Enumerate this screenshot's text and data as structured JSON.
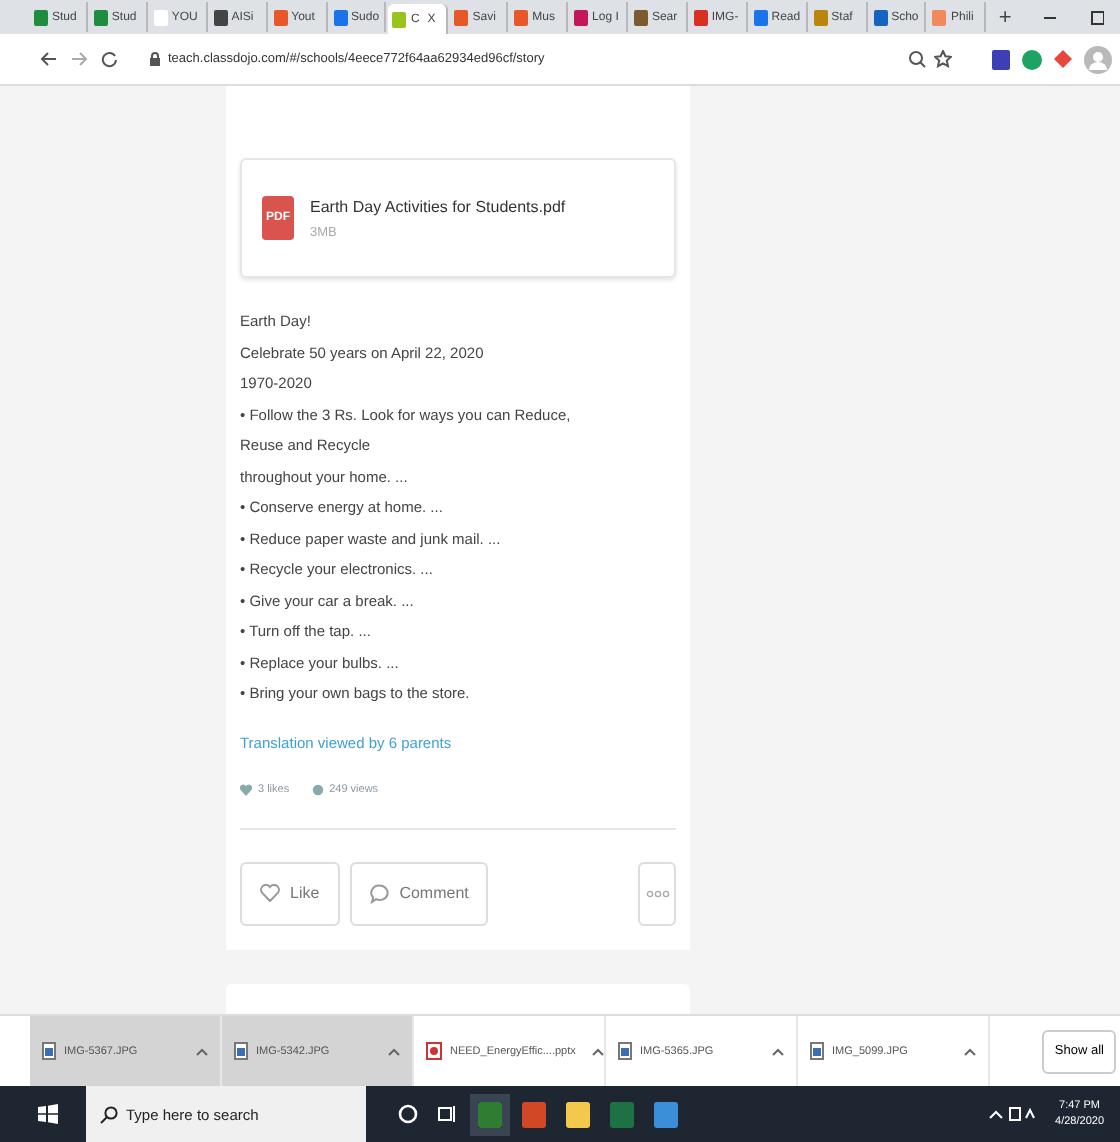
{
  "browser": {
    "tabs": [
      {
        "label": "Stud",
        "color": "#1e8e3e",
        "selected": false
      },
      {
        "label": "Stud",
        "color": "#1e8e3e",
        "selected": false
      },
      {
        "label": "YOU",
        "color": "#ffffff",
        "selected": false
      },
      {
        "label": "AISi",
        "color": "#444444",
        "selected": false
      },
      {
        "label": "Yout",
        "color": "#e8572a",
        "selected": false
      },
      {
        "label": "Sudo",
        "color": "#1a73e8",
        "selected": false
      },
      {
        "label": "C",
        "color": "#9ac31c",
        "selected": true
      },
      {
        "label": "Savi",
        "color": "#e8572a",
        "selected": false
      },
      {
        "label": "Mus",
        "color": "#e8572a",
        "selected": false
      },
      {
        "label": "Log I",
        "color": "#c2185b",
        "selected": false
      },
      {
        "label": "Sear",
        "color": "#7a5c2e",
        "selected": false
      },
      {
        "label": "IMG-",
        "color": "#d93025",
        "selected": false
      },
      {
        "label": "Read",
        "color": "#1a73e8",
        "selected": false
      },
      {
        "label": "Staf",
        "color": "#b8860b",
        "selected": false
      },
      {
        "label": "Scho",
        "color": "#1565c0",
        "selected": false
      },
      {
        "label": "Phili",
        "color": "#f08a5d",
        "selected": false
      }
    ],
    "close_tab": "X",
    "new_tab": "+",
    "url": "teach.classdojo.com/#/schools/4eece772f64aa62934ed96cf/story"
  },
  "post": {
    "attachment": {
      "name": "Earth Day Activities for Students.pdf",
      "size": "3MB",
      "badge": "PDF"
    },
    "lines": [
      "Earth Day!",
      "Celebrate 50 years on April 22, 2020",
      "1970-2020",
      "• Follow the 3 Rs. Look for ways you can Reduce,",
      "Reuse and Recycle",
      "throughout your home. ...",
      "• Conserve energy at home. ...",
      "• Reduce paper waste and junk mail. ...",
      "• Recycle your electronics. ...",
      "• Give your car a break. ...",
      "• Turn off the tap. ...",
      "• Replace your bulbs. ...",
      "• Bring your own bags to the store."
    ],
    "translation": "Translation viewed by 6 parents",
    "likes": "3 likes",
    "views": "249 views",
    "buttons": [
      {
        "label": "Like",
        "kind": "like"
      },
      {
        "label": "Comment",
        "kind": "comment"
      }
    ]
  },
  "downloads": {
    "items": [
      {
        "name": "IMG-5367.JPG",
        "kind": "image",
        "selected": true
      },
      {
        "name": "IMG-5342.JPG",
        "kind": "image",
        "selected": true
      },
      {
        "name": "NEED_EnergyEffic....pptx",
        "kind": "slides",
        "selected": false
      },
      {
        "name": "IMG-5365.JPG",
        "kind": "image",
        "selected": false
      },
      {
        "name": "IMG_5099.JPG",
        "kind": "image",
        "selected": false
      }
    ],
    "show_all": "Show all"
  },
  "taskbar": {
    "search_placeholder": "Type here to search",
    "apps": [
      {
        "kind": "cortana"
      },
      {
        "kind": "taskview"
      },
      {
        "kind": "chrome"
      },
      {
        "kind": "powerpoint"
      },
      {
        "kind": "files"
      },
      {
        "kind": "excel"
      },
      {
        "kind": "photos"
      }
    ],
    "time": "7:47 PM",
    "date": "4/28/2020"
  }
}
